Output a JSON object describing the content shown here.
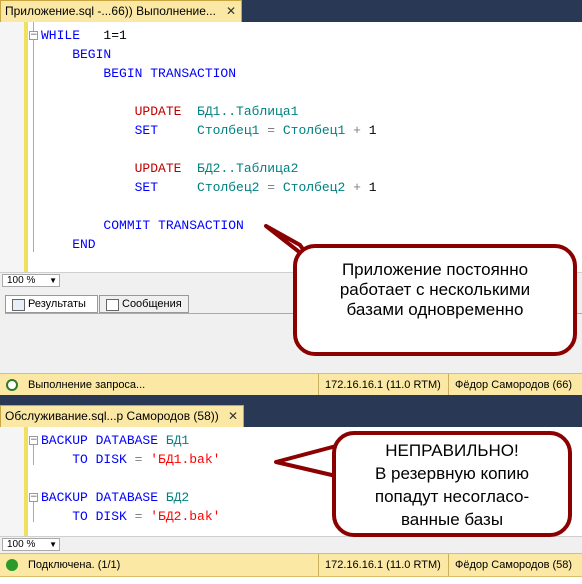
{
  "window1": {
    "tab_active": "Приложение.sql -...66)) Выполнение...",
    "tab_close": "✕",
    "code_lines": [
      [
        {
          "t": "WHILE",
          "c": "kw"
        },
        {
          "t": "   1=1",
          "c": ""
        }
      ],
      [
        {
          "t": "    BEGIN",
          "c": "kw"
        }
      ],
      [
        {
          "t": "        BEGIN TRANSACTION",
          "c": "kw"
        }
      ],
      [],
      [
        {
          "t": "            UPDATE",
          "c": "red"
        },
        {
          "t": "  БД1..Таблица1",
          "c": "teal"
        }
      ],
      [
        {
          "t": "            SET",
          "c": "kw"
        },
        {
          "t": "     Столбец1 ",
          "c": "teal"
        },
        {
          "t": "=",
          "c": "gray"
        },
        {
          "t": " Столбец1 ",
          "c": "teal"
        },
        {
          "t": "+",
          "c": "gray"
        },
        {
          "t": " 1",
          "c": ""
        }
      ],
      [],
      [
        {
          "t": "            UPDATE",
          "c": "red"
        },
        {
          "t": "  БД2..Таблица2",
          "c": "teal"
        }
      ],
      [
        {
          "t": "            SET",
          "c": "kw"
        },
        {
          "t": "     Столбец2 ",
          "c": "teal"
        },
        {
          "t": "=",
          "c": "gray"
        },
        {
          "t": " Столбец2 ",
          "c": "teal"
        },
        {
          "t": "+",
          "c": "gray"
        },
        {
          "t": " 1",
          "c": ""
        }
      ],
      [],
      [
        {
          "t": "        COMMIT TRANSACTION",
          "c": "kw"
        }
      ],
      [
        {
          "t": "    END",
          "c": "kw"
        }
      ]
    ],
    "zoom": "100 %",
    "results_tab": "Результаты",
    "messages_tab": "Сообщения",
    "status_text": "Выполнение запроса...",
    "server": "172.16.16.1 (11.0 RTM)",
    "user": "Фёдор Самородов (66)"
  },
  "window2": {
    "tab_active": "Обслуживание.sql...р Самородов (58))",
    "tab_close": "✕",
    "code_lines": [
      [
        {
          "t": "BACKUP DATABASE",
          "c": "kw"
        },
        {
          "t": " БД1",
          "c": "teal"
        }
      ],
      [
        {
          "t": "    TO DISK",
          "c": "kw"
        },
        {
          "t": " = ",
          "c": "gray"
        },
        {
          "t": "'БД1.bak'",
          "c": "str"
        }
      ],
      [],
      [
        {
          "t": "BACKUP DATABASE",
          "c": "kw"
        },
        {
          "t": " БД2",
          "c": "teal"
        }
      ],
      [
        {
          "t": "    TO DISK",
          "c": "kw"
        },
        {
          "t": " = ",
          "c": "gray"
        },
        {
          "t": "'БД2.bak'",
          "c": "str"
        }
      ]
    ],
    "zoom": "100 %",
    "status_text": "Подключена. (1/1)",
    "server": "172.16.16.1 (11.0 RTM)",
    "user": "Фёдор Самородов (58)"
  },
  "callouts": {
    "top": [
      "Приложение постоянно",
      "работает с несколькими",
      "базами одновременно"
    ],
    "bottom": [
      "НЕПРАВИЛЬНО!",
      "В резервную копию",
      "попадут несогласо-",
      "ванные базы"
    ]
  }
}
